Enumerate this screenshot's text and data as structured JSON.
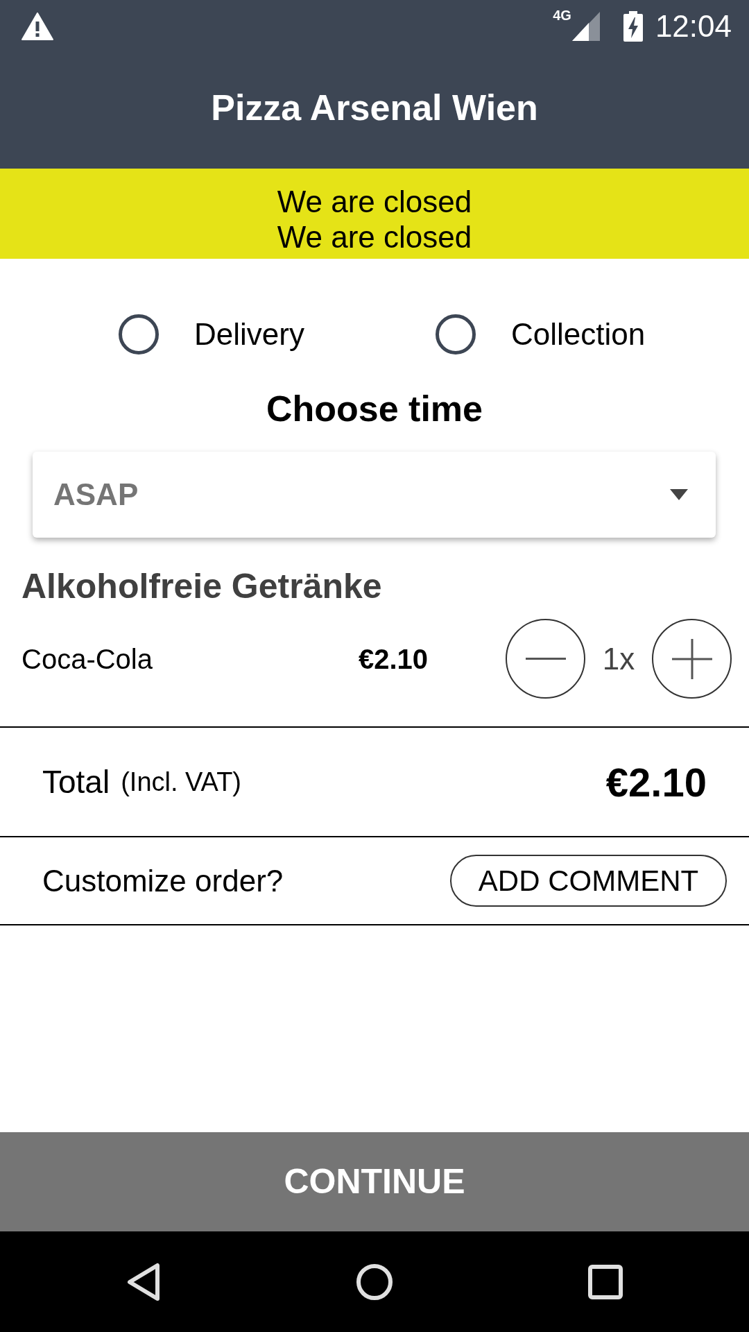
{
  "status_bar": {
    "network": "4G",
    "time": "12:04"
  },
  "header": {
    "title": "Pizza Arsenal Wien"
  },
  "banner": {
    "lines": [
      "We are closed",
      "We are closed"
    ]
  },
  "order_types": [
    {
      "label": "Delivery",
      "selected": false
    },
    {
      "label": "Collection",
      "selected": false
    }
  ],
  "time_section": {
    "heading": "Choose time",
    "dropdown": {
      "value": "ASAP"
    }
  },
  "category": {
    "title": "Alkoholfreie Getränke",
    "items": [
      {
        "name": "Coca-Cola",
        "price": "€2.10",
        "quantity": "1x"
      }
    ]
  },
  "total": {
    "label": "Total",
    "note": "(Incl. VAT)",
    "amount": "€2.10"
  },
  "customize": {
    "prompt": "Customize order?",
    "button": "ADD COMMENT"
  },
  "continue_button": {
    "label": "CONTINUE"
  }
}
